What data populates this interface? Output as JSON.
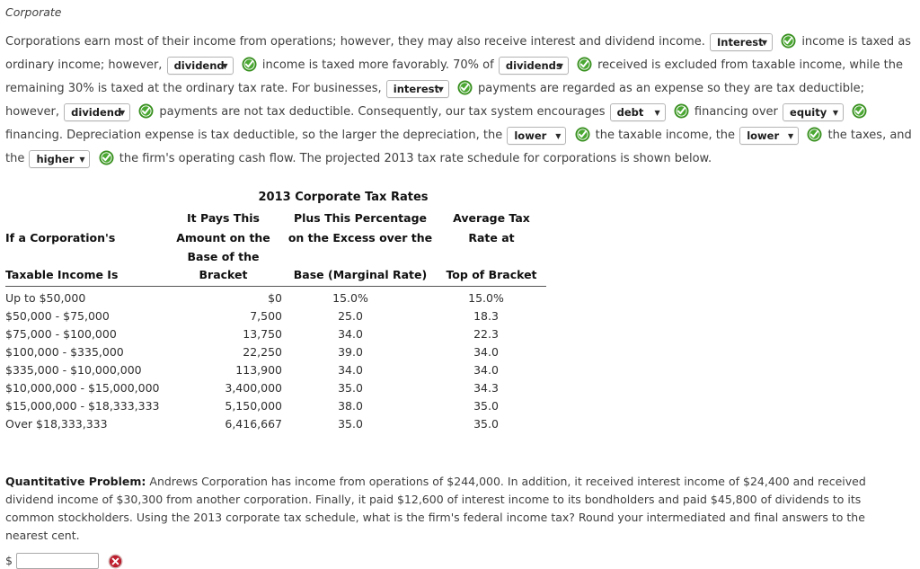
{
  "section": {
    "heading": "Corporate"
  },
  "paragraph": {
    "t1": "Corporations earn most of their income from operations; however, they may also receive interest and dividend income.",
    "t2": "income is taxed as ordinary income; however,",
    "t3": "income is taxed more favorably. 70% of",
    "t4": "received is excluded from taxable income, while the remaining 30% is taxed at the ordinary tax rate. For businesses,",
    "t5": "payments are regarded as an expense so they are tax deductible; however,",
    "t6": "payments are not tax deductible. Consequently, our tax system encourages",
    "t7": "financing over",
    "t8": "financing. Depreciation expense is tax deductible, so the larger the depreciation, the",
    "t9": "the taxable income, the",
    "t10": "the taxes, and the",
    "t11": "the firm's operating cash flow. The projected 2013 tax rate schedule for corporations is shown below."
  },
  "selects": {
    "s1": "Interest",
    "s2": "dividend",
    "s3": "dividends",
    "s4": "interest",
    "s5": "dividend",
    "s6": "debt",
    "s7": "equity",
    "s8": "lower",
    "s9": "lower",
    "s10": "higher"
  },
  "icons": {
    "check": "check-circle-icon",
    "error": "error-circle-icon",
    "caret": "chevron-down-icon"
  },
  "chart_data": {
    "type": "table",
    "title": "2013 Corporate Tax Rates",
    "columns": [
      "If a Corporation's Taxable Income Is",
      "It Pays This Amount on the Base of the Bracket",
      "Plus This Percentage on the Excess over the Base (Marginal Rate)",
      "Average Tax Rate at Top of Bracket"
    ],
    "header_lines": {
      "c1": [
        "",
        "If a Corporation's",
        "Taxable Income Is"
      ],
      "c2": [
        "It Pays This",
        "Amount on the",
        "Base of the Bracket"
      ],
      "c3": [
        "Plus This Percentage",
        "on the Excess over the",
        "Base (Marginal Rate)"
      ],
      "c4": [
        "Average Tax",
        "Rate at",
        "Top of Bracket"
      ]
    },
    "rows": [
      {
        "bracket": "Up to $50,000",
        "base_tax": "$0",
        "marginal_rate": "15.0%",
        "avg_rate": "15.0%"
      },
      {
        "bracket": "$50,000 - $75,000",
        "base_tax": "7,500",
        "marginal_rate": "25.0",
        "avg_rate": "18.3"
      },
      {
        "bracket": "$75,000 - $100,000",
        "base_tax": "13,750",
        "marginal_rate": "34.0",
        "avg_rate": "22.3"
      },
      {
        "bracket": "$100,000 - $335,000",
        "base_tax": "22,250",
        "marginal_rate": "39.0",
        "avg_rate": "34.0"
      },
      {
        "bracket": "$335,000 - $10,000,000",
        "base_tax": "113,900",
        "marginal_rate": "34.0",
        "avg_rate": "34.0"
      },
      {
        "bracket": "$10,000,000 - $15,000,000",
        "base_tax": "3,400,000",
        "marginal_rate": "35.0",
        "avg_rate": "34.3"
      },
      {
        "bracket": "$15,000,000 - $18,333,333",
        "base_tax": "5,150,000",
        "marginal_rate": "38.0",
        "avg_rate": "35.0"
      },
      {
        "bracket": "Over $18,333,333",
        "base_tax": "6,416,667",
        "marginal_rate": "35.0",
        "avg_rate": "35.0"
      }
    ]
  },
  "problem": {
    "label": "Quantitative Problem:",
    "body": " Andrews Corporation has income from operations of $244,000. In addition, it received interest income of $24,400 and received dividend income of $30,300 from another corporation. Finally, it paid $12,600 of interest income to its bondholders and paid $45,800 of dividends to its common stockholders. Using the 2013 corporate tax schedule, what is the firm's federal income tax? Round your intermediated and final answers to the nearest cent."
  },
  "answer": {
    "currency_symbol": "$",
    "value": "",
    "placeholder": ""
  },
  "colors": {
    "check_green": "#3f9c35",
    "error_red": "#c0182a",
    "text": "#3f3f3f"
  }
}
